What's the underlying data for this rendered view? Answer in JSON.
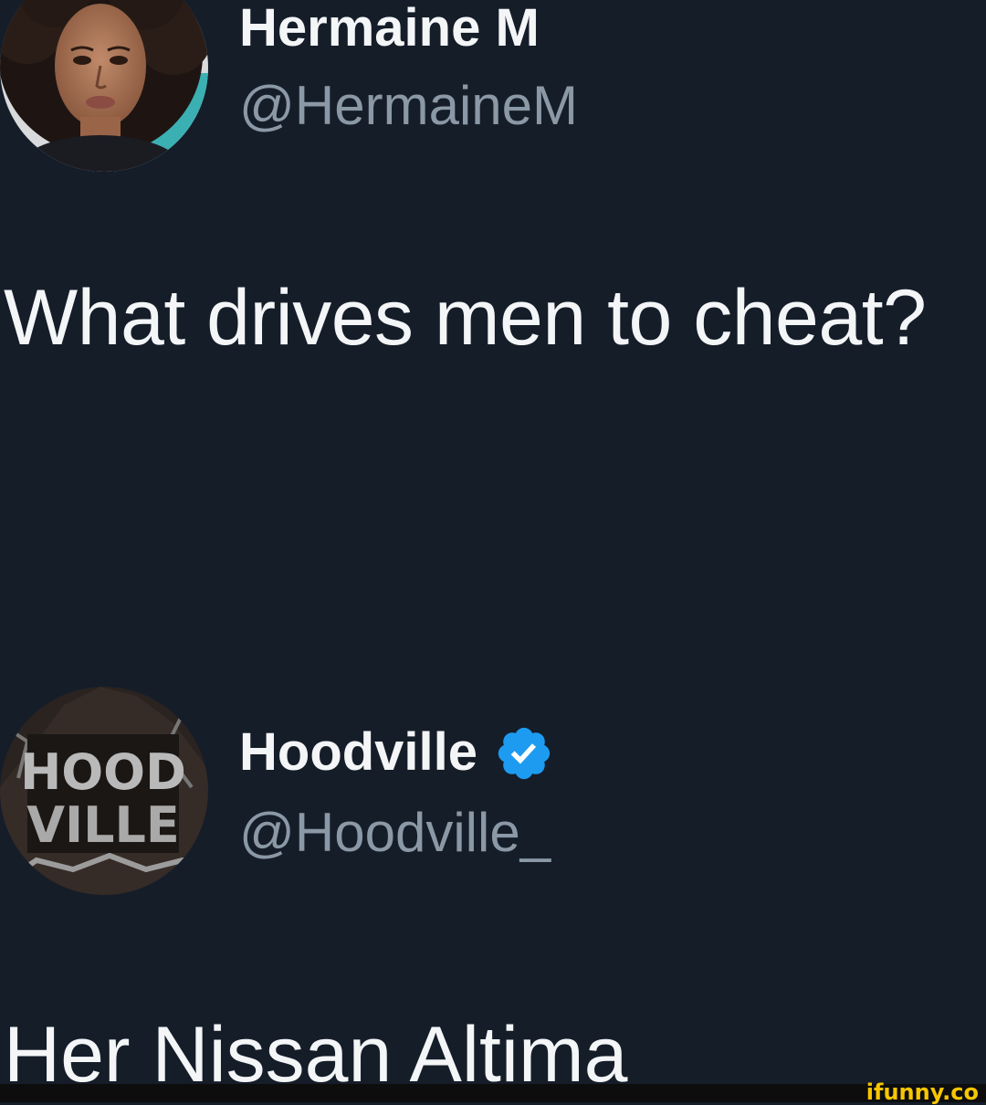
{
  "tweet": {
    "author_name": "Hermaine M",
    "author_handle": "@HermaineM",
    "text": "What drives men to cheat?",
    "avatar_icon": "person-portrait-avatar"
  },
  "reply": {
    "author_name": "Hoodville",
    "author_handle": "@Hoodville_",
    "verified": true,
    "verified_icon": "verified-badge-icon",
    "verified_color": "#1d9bf0",
    "text": "Her Nissan Altima",
    "avatar_logo_text": [
      "HOOD",
      "VILLE"
    ]
  },
  "watermark": "ifunny.co",
  "colors": {
    "background": "#151d29",
    "primary_text": "#f3f5f7",
    "secondary_text": "#8b98a5",
    "watermark": "#f7c600"
  }
}
